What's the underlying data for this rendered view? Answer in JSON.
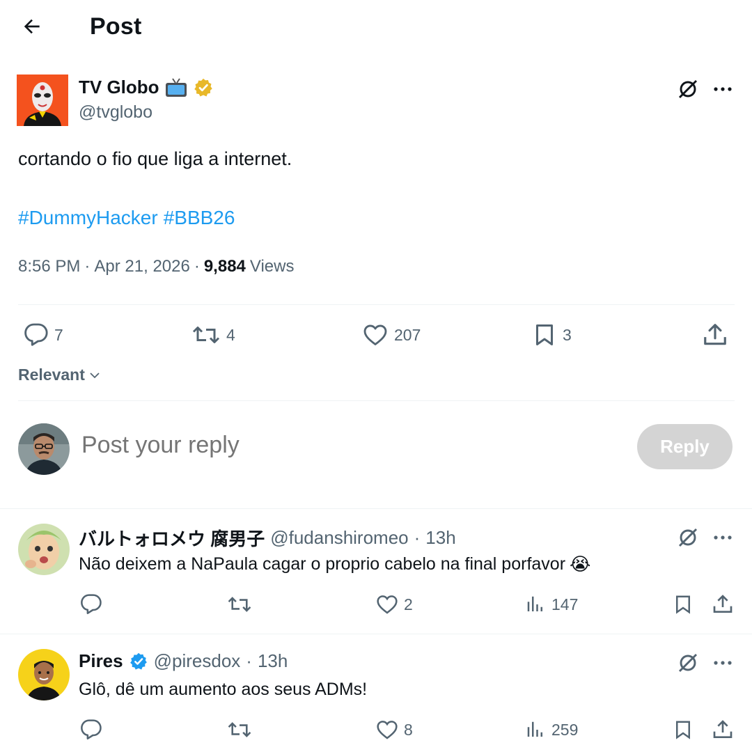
{
  "header": {
    "title": "Post"
  },
  "post": {
    "author_name": "TV Globo",
    "author_handle": "@tvglobo",
    "text": "cortando o fio que liga a internet.",
    "hashtags": [
      "#DummyHacker",
      "#BBB26"
    ],
    "time": "8:56 PM",
    "date": "Apr 21, 2026",
    "views_count": "9,884",
    "views_label": "Views",
    "separator": "·",
    "stats": {
      "replies": "7",
      "reposts": "4",
      "likes": "207",
      "bookmarks": "3"
    }
  },
  "sort": {
    "label": "Relevant"
  },
  "compose": {
    "placeholder": "Post your reply",
    "button_label": "Reply"
  },
  "replies": [
    {
      "name": "バルトォロメウ 腐男子",
      "handle": "@fudanshiromeo",
      "time": "13h",
      "text": "Não deixem a NaPaula cagar o proprio cabelo na final porfavor",
      "emoji": "😭",
      "likes": "2",
      "views": "147"
    },
    {
      "name": "Pires",
      "handle": "@piresdox",
      "time": "13h",
      "text": "Glô, dê um aumento aos seus ADMs!",
      "likes": "8",
      "views": "259"
    }
  ],
  "colors": {
    "link": "#1d9bf0",
    "muted": "#536471",
    "text": "#0f1419",
    "gold_badge": "#e8b829",
    "blue_badge": "#1d9bf0",
    "reply_disabled": "#d4d4d4"
  },
  "icons": [
    "back-arrow-icon",
    "tv-emoji-icon",
    "gold-verified-icon",
    "grok-icon",
    "more-icon",
    "reply-icon",
    "repost-icon",
    "like-icon",
    "bookmark-icon",
    "share-icon",
    "views-icon",
    "chevron-down-icon",
    "blue-verified-icon"
  ]
}
